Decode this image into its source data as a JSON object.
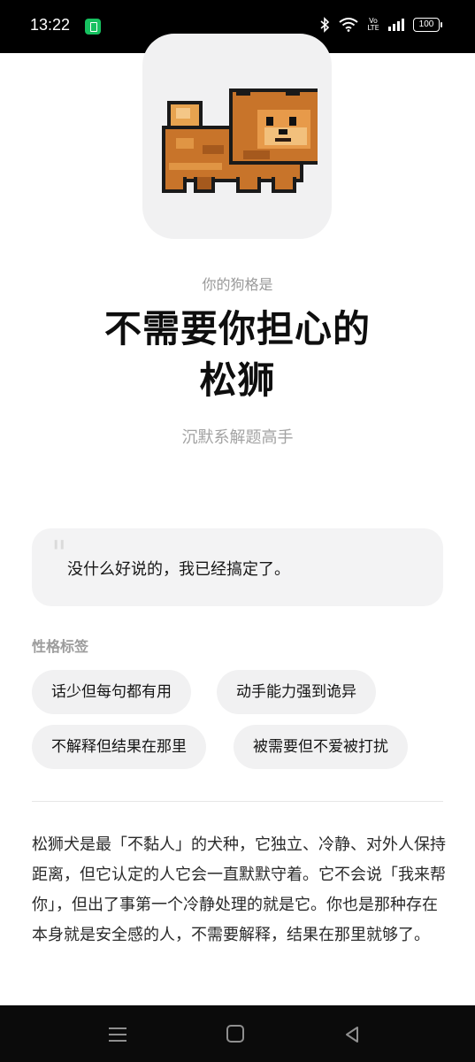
{
  "status_bar": {
    "time": "13:22",
    "network_label": "Vo LTE",
    "battery": "100"
  },
  "result": {
    "kicker": "你的狗格是",
    "title_line1": "不需要你担心的",
    "title_line2": "松狮",
    "subtitle": "沉默系解题高手"
  },
  "quote": {
    "text": "没什么好说的，我已经搞定了。"
  },
  "traits": {
    "label": "性格标签",
    "tags": [
      "话少但每句都有用",
      "动手能力强到诡异",
      "不解释但结果在那里",
      "被需要但不爱被打扰"
    ]
  },
  "description": "松狮犬是最「不黏人」的犬种，它独立、冷静、对外人保持距离，但它认定的人它会一直默默守着。它不会说「我来帮你」，但出了事第一个冷静处理的就是它。你也是那种存在本身就是安全感的人，不需要解释，结果在那里就够了。",
  "colors": {
    "accent_dog": "#c8742a",
    "card_bg": "#f1f1f2",
    "muted_text": "#9a9a9a"
  },
  "icons": [
    "bluetooth-icon",
    "wifi-icon",
    "signal-icon",
    "battery-icon",
    "menu-icon",
    "home-icon",
    "back-icon"
  ]
}
